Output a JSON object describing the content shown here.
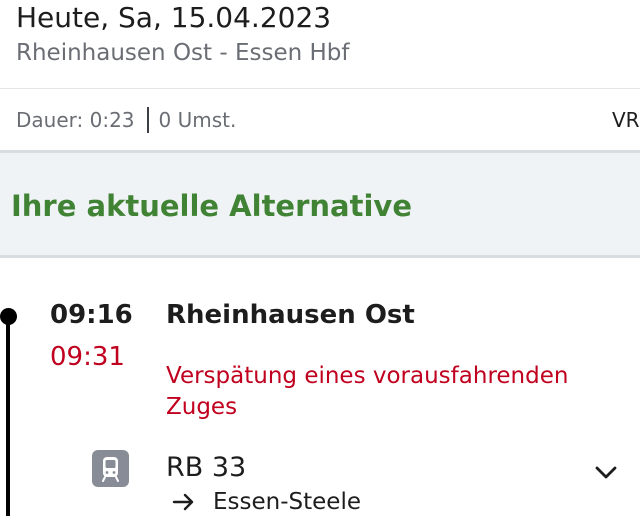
{
  "header": {
    "date": "Heute, Sa, 15.04.2023",
    "route": "Rheinhausen Ost - Essen Hbf",
    "duration": "Dauer: 0:23",
    "transfers": "0 Umst.",
    "right_clipped": "VR"
  },
  "alternative": {
    "title": "Ihre aktuelle Alternative"
  },
  "stop": {
    "planned_time": "09:16",
    "actual_time": "09:31",
    "station": "Rheinhausen Ost",
    "delay_reason": "Verspätung eines vorausfahrenden Zuges"
  },
  "train": {
    "line": "RB 33",
    "direction": "Essen-Steele",
    "icon": "train-icon",
    "expand_icon": "chevron-down-icon"
  },
  "colors": {
    "accent_green": "#408335",
    "delay_red": "#c0001e",
    "banner_bg": "#f0f3f5",
    "icon_gray": "#878c96"
  }
}
